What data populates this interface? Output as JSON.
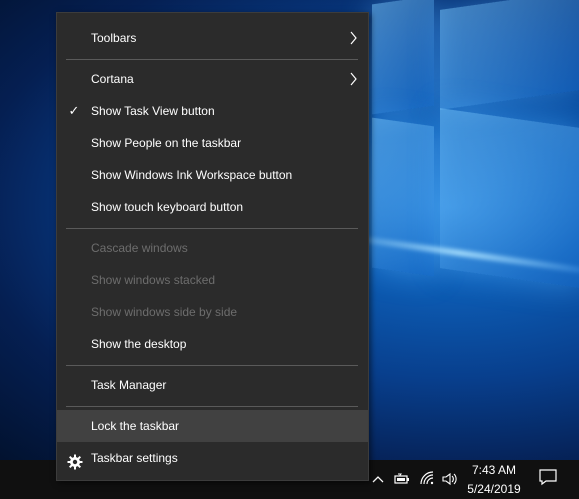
{
  "context_menu": {
    "items": [
      {
        "label": "Toolbars",
        "submenu": true
      },
      {
        "label": "Cortana",
        "submenu": true
      },
      {
        "label": "Show Task View button",
        "checked": true
      },
      {
        "label": "Show People on the taskbar"
      },
      {
        "label": "Show Windows Ink Workspace button"
      },
      {
        "label": "Show touch keyboard button"
      },
      {
        "label": "Cascade windows",
        "disabled": true
      },
      {
        "label": "Show windows stacked",
        "disabled": true
      },
      {
        "label": "Show windows side by side",
        "disabled": true
      },
      {
        "label": "Show the desktop"
      },
      {
        "label": "Task Manager"
      },
      {
        "label": "Lock the taskbar",
        "hovered": true
      },
      {
        "label": "Taskbar settings",
        "icon": "gear-icon"
      }
    ],
    "check_glyph": "✓",
    "submenu_icon": "chevron-right-icon"
  },
  "taskbar": {
    "tray_icons": [
      "chevron-up-icon",
      "battery-icon",
      "wifi-icon",
      "volume-icon"
    ],
    "clock": {
      "time": "7:43 AM",
      "date": "5/24/2019"
    },
    "notification_icon": "action-center-icon"
  },
  "colors": {
    "menu_background": "#2b2b2b",
    "menu_hover": "#414141",
    "menu_text": "#ffffff",
    "menu_disabled_text": "#6d6d6d",
    "separator": "#5a5a5a",
    "taskbar": "#101010"
  }
}
